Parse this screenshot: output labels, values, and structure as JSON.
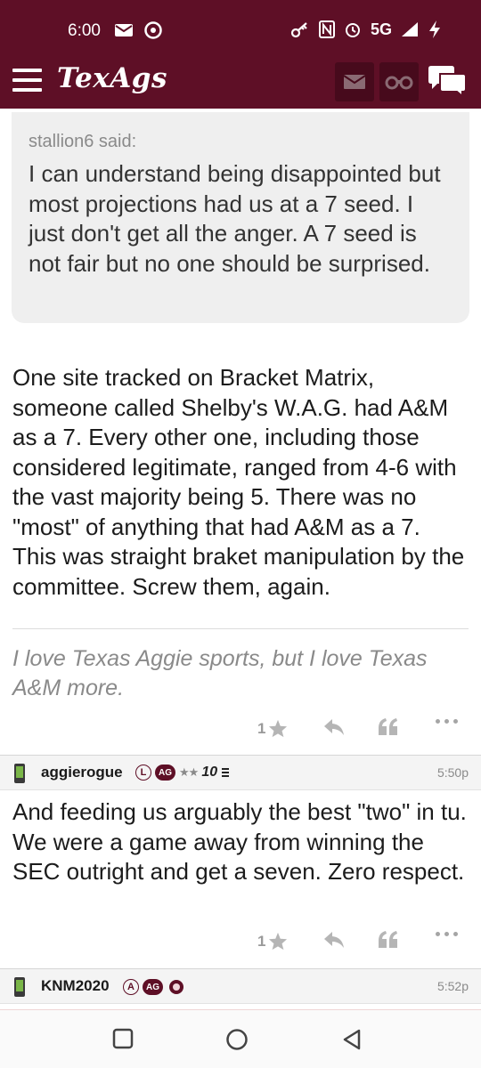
{
  "status_bar": {
    "time": "6:00",
    "network": "5G",
    "icons": [
      "mail-icon",
      "chrome-icon",
      "key-icon",
      "nfc-icon",
      "alarm-icon",
      "signal-icon",
      "charging-icon"
    ]
  },
  "header": {
    "logo": "TexAgs",
    "colors": {
      "brand": "#5e0f26",
      "button_bg": "#470a1c"
    }
  },
  "quote": {
    "author": "stallion6 said:",
    "text": "I can understand being disappointed but most projections had us at a 7 seed. I just don't get all the anger. A 7 seed is not fair but no one should be surprised."
  },
  "posts": [
    {
      "body": "One site tracked on Bracket Matrix, someone called Shelby's W.A.G. had A&M as a 7. Every other one, including those considered legitimate, ranged from 4-6 with the vast majority being 5. There was no \"most\" of anything that had A&M as a 7. This was straight braket manipulation by the committee. Screw them, again.",
      "signature": "I love Texas Aggie sports, but I love Texas A&M more.",
      "stars": "1"
    },
    {
      "username": "aggierogue",
      "badge_letter": "L",
      "badge_ag": "AG",
      "badge_stars": "★★",
      "badge_rank": "10",
      "time": "5:50p",
      "body": "And feeding us arguably the best \"two\" in tu. We were a game away from winning the SEC outright and get a seven. Zero respect.",
      "stars": "1"
    },
    {
      "username": "KNM2020",
      "badge_letter": "A",
      "badge_ag": "AG",
      "time": "5:52p"
    }
  ]
}
